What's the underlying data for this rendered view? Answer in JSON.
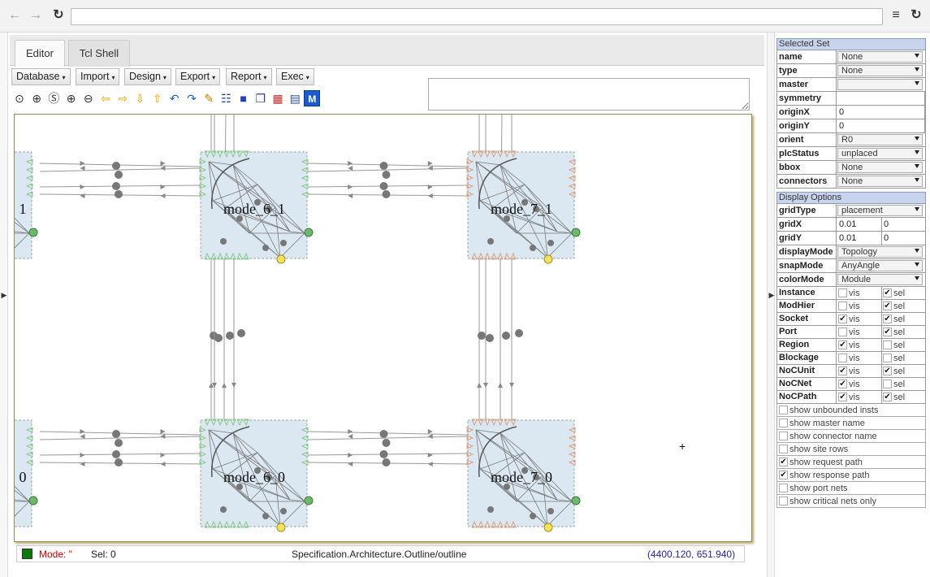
{
  "browser": {
    "url": "",
    "back_icon": "left-arrow-icon",
    "forward_icon": "right-arrow-icon",
    "reload_icon": "reload-icon",
    "menu_icon": "hamburger-icon"
  },
  "tabs": [
    {
      "label": "Editor",
      "active": true
    },
    {
      "label": "Tcl Shell",
      "active": false
    }
  ],
  "menus": [
    "Database",
    "Import",
    "Design",
    "Export",
    "Report",
    "Exec"
  ],
  "tools": [
    "zoom-fit-icon",
    "zoom-area-icon",
    "zoom-select-icon",
    "zoom-in-icon",
    "zoom-out-icon",
    "pan-left-icon",
    "pan-right-icon",
    "pan-down-icon",
    "pan-up-icon",
    "undo-icon",
    "redo-icon",
    "ruler-icon",
    "inspect-icon",
    "highlight-icon",
    "copy-icon",
    "grid-icon",
    "grid-alt-icon",
    "module-icon"
  ],
  "module_tool_label": "M",
  "canvas": {
    "modules": [
      {
        "label": "1"
      },
      {
        "label": "mode_6_1"
      },
      {
        "label": "mode_7_1"
      },
      {
        "label": "0"
      },
      {
        "label": "mode_6_0"
      },
      {
        "label": "mode_7_0"
      }
    ],
    "cursor": "+"
  },
  "status": {
    "mode_label": "Mode: \"",
    "sel_label": "Sel: 0",
    "path": "Specification.Architecture.Outline/outline",
    "coords": "(4400.120, 651.940)",
    "mode_color": "#0a7a0a"
  },
  "selected_set": {
    "title": "Selected Set",
    "rows": [
      {
        "label": "name",
        "kind": "select",
        "value": "None"
      },
      {
        "label": "type",
        "kind": "select",
        "value": "None"
      },
      {
        "label": "master",
        "kind": "select",
        "value": ""
      },
      {
        "label": "symmetry",
        "kind": "text",
        "value": ""
      },
      {
        "label": "originX",
        "kind": "text",
        "value": "0"
      },
      {
        "label": "originY",
        "kind": "text",
        "value": "0"
      },
      {
        "label": "orient",
        "kind": "select",
        "value": "R0"
      },
      {
        "label": "plcStatus",
        "kind": "select",
        "value": "unplaced"
      },
      {
        "label": "bbox",
        "kind": "select",
        "value": "None"
      },
      {
        "label": "connectors",
        "kind": "select",
        "value": "None"
      }
    ]
  },
  "display_options": {
    "title": "Display Options",
    "rows": [
      {
        "label": "gridType",
        "kind": "select",
        "value": "placement"
      },
      {
        "label": "gridX",
        "kind": "pair",
        "value": "0.01",
        "value2": "0"
      },
      {
        "label": "gridY",
        "kind": "pair",
        "value": "0.01",
        "value2": "0"
      },
      {
        "label": "displayMode",
        "kind": "select",
        "value": "Topology"
      },
      {
        "label": "snapMode",
        "kind": "select",
        "value": "AnyAngle"
      },
      {
        "label": "colorMode",
        "kind": "select",
        "value": "Module"
      }
    ],
    "layers": [
      {
        "label": "Instance",
        "vis": false,
        "sel": true
      },
      {
        "label": "ModHier",
        "vis": false,
        "sel": true
      },
      {
        "label": "Socket",
        "vis": true,
        "sel": true
      },
      {
        "label": "Port",
        "vis": false,
        "sel": true
      },
      {
        "label": "Region",
        "vis": true,
        "sel": false
      },
      {
        "label": "Blockage",
        "vis": false,
        "sel": false
      },
      {
        "label": "NoCUnit",
        "vis": true,
        "sel": true
      },
      {
        "label": "NoCNet",
        "vis": true,
        "sel": false
      },
      {
        "label": "NoCPath",
        "vis": true,
        "sel": true
      }
    ],
    "vis_label": "vis",
    "sel_label": "sel",
    "options": [
      {
        "label": "show unbounded insts",
        "checked": false
      },
      {
        "label": "show master name",
        "checked": false
      },
      {
        "label": "show connector name",
        "checked": false
      },
      {
        "label": "show site rows",
        "checked": false
      },
      {
        "label": "show request path",
        "checked": true
      },
      {
        "label": "show response path",
        "checked": true
      },
      {
        "label": "show port nets",
        "checked": false
      },
      {
        "label": "show critical nets only",
        "checked": false
      }
    ]
  }
}
